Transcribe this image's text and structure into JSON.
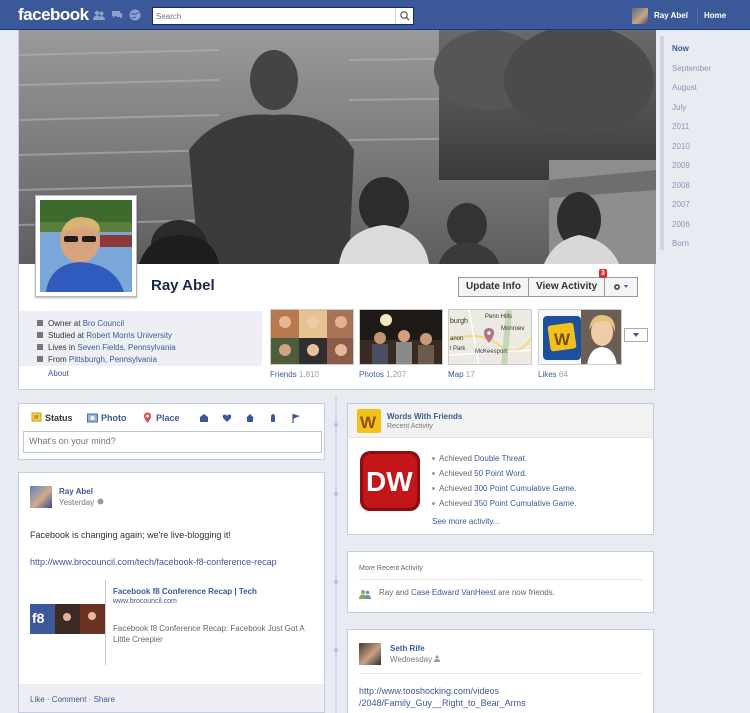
{
  "header": {
    "logo": "facebook",
    "search_placeholder": "Search",
    "user_name": "Ray Abel",
    "home_label": "Home",
    "brand_color": "#3b5998"
  },
  "timeline_nav": [
    "Now",
    "September",
    "August",
    "July",
    "2011",
    "2010",
    "2009",
    "2008",
    "2007",
    "2006",
    "Born"
  ],
  "profile": {
    "name": "Ray Abel",
    "buttons": {
      "update_info": "Update Info",
      "view_activity": "View Activity",
      "activity_badge": "3"
    },
    "info": [
      {
        "prefix": "Owner at ",
        "link": "Bro Council",
        "icon": "briefcase-icon"
      },
      {
        "prefix": "Studied at ",
        "link": "Robert Morris University",
        "icon": "school-icon"
      },
      {
        "prefix": "Lives in ",
        "link": "Seven Fields, Pennsylvania",
        "icon": "house-icon"
      },
      {
        "prefix": "From ",
        "link": "Pittsburgh, Pennsylvania",
        "icon": "house-icon"
      }
    ],
    "about_label": "About",
    "tiles": {
      "friends": {
        "label": "Friends",
        "count": "1,810"
      },
      "photos": {
        "label": "Photos",
        "count": "1,207"
      },
      "map": {
        "label": "Map",
        "count": "17",
        "places": [
          "Penn Hills",
          "burgh",
          "Monroev",
          "anon",
          "l Park",
          "McKeesport"
        ]
      },
      "likes": {
        "label": "Likes",
        "count": "64"
      }
    }
  },
  "composer": {
    "tabs": {
      "status": "Status",
      "photo": "Photo",
      "place": "Place"
    },
    "placeholder": "What's on your mind?"
  },
  "post": {
    "author": "Ray Abel",
    "time": "Yesterday",
    "text": "Facebook is changing again; we're live-blogging it!",
    "link": "http://www.brocouncil.com/tech/facebook-f8-conference-recap",
    "share": {
      "title": "Facebook f8 Conference Recap | Tech",
      "domain": "www.brocouncil.com",
      "description": "Facebook f8 Conference Recap: Facebook Just Got A Little Creepier",
      "thumb_text": "f8"
    },
    "actions": "Like · Comment · Share"
  },
  "wwf": {
    "title": "Words With Friends",
    "subtitle": "Recent Activity",
    "logo_text": "DW",
    "achievements": [
      {
        "prefix": "Achieved ",
        "link": "Double Threat."
      },
      {
        "prefix": "Achieved ",
        "link": "50 Point Word."
      },
      {
        "prefix": "Achieved ",
        "link": "300 Point Cumulative Game."
      },
      {
        "prefix": "Achieved ",
        "link": "350 Point Cumulative Game."
      }
    ],
    "see_more": "See more activity..."
  },
  "more_activity": {
    "title": "More Recent Activity",
    "text_a": "Ray",
    "text_mid": " and ",
    "text_b": "Case Edward VanHeest",
    "text_end": " are now friends."
  },
  "seth": {
    "author": "Seth Rife",
    "time": "Wednesday",
    "link_line1": "http://www.tooshocking.com/videos",
    "link_line2": "/2048/Family_Guy__Right_to_Bear_Arms"
  }
}
